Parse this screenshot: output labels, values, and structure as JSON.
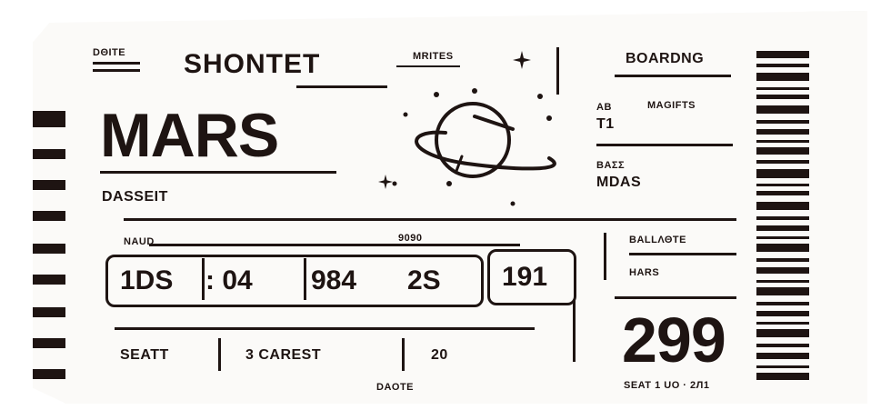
{
  "ticket": {
    "label_date": "DΘITE",
    "title": "SHONTET",
    "label_mrites": "MRITES",
    "boarding": "BOARDNG",
    "destination": "MARS",
    "subtitle": "DASSEIT",
    "label_ab": "ΑΒ",
    "label_magifts": "MAGIFTS",
    "gate_code": "T1",
    "label_pass": "ΒΑΣΣ",
    "pass_value": "MDAS",
    "label_naud": "NAUD",
    "label_9090": "9090",
    "code_1": "1DS",
    "code_2": ": 04",
    "code_3": "984",
    "code_4": "2S",
    "code_5": "191",
    "label_ballaste": "BALLΛΘTE",
    "ballaste_value": "HARS",
    "seat_label": "SEATT",
    "carest": "3 CAREST",
    "seat_num": "20",
    "label_daote": "DAOTE",
    "price": "299",
    "seat_footer": "SEAT 1 UO · 2Л1"
  },
  "colors": {
    "ink": "#1e1412",
    "paper": "#fbfaf8"
  },
  "icons": [
    "planet-icon",
    "sparkle-icon",
    "barcode-icon",
    "perforation-strips"
  ]
}
